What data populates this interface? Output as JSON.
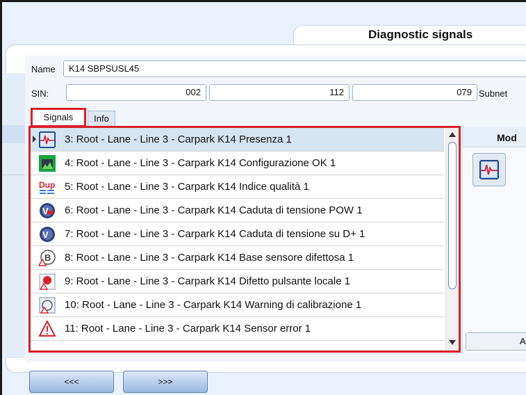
{
  "header": {
    "title": "Diagnostic signals"
  },
  "form": {
    "name_label": "Name",
    "name_value": "K14 SBPSUSL45",
    "sin_label": "SIN:",
    "sin_values": [
      "002",
      "112",
      "079"
    ],
    "subnet_label": "Subnet"
  },
  "tabs": [
    {
      "label": "Signals",
      "selected": true
    },
    {
      "label": "Info",
      "selected": false
    }
  ],
  "signals": [
    {
      "text": "3: Root - Lane - Line 3 - Carpark K14 Presenza 1",
      "icon": "presence-signal-icon",
      "selected": true
    },
    {
      "text": "4: Root - Lane - Line 3 - Carpark K14 Configurazione OK 1",
      "icon": "configuration-ok-icon"
    },
    {
      "text": "5: Root - Lane - Line 3 - Carpark K14 Indice qualità 1",
      "icon": "dup-quality-icon"
    },
    {
      "text": "6: Root - Lane - Line 3 - Carpark K14 Caduta di tensione POW 1",
      "icon": "voltage-pow-icon"
    },
    {
      "text": "7: Root - Lane - Line 3 - Carpark K14 Caduta di tensione su D+ 1",
      "icon": "voltage-dup-icon"
    },
    {
      "text": "8: Root - Lane - Line 3 - Carpark K14 Base sensore difettosa 1",
      "icon": "sensor-base-warning-icon"
    },
    {
      "text": "9: Root - Lane - Line 3 - Carpark K14 Difetto pulsante locale 1",
      "icon": "local-button-fault-icon"
    },
    {
      "text": "10: Root - Lane - Line 3 - Carpark K14 Warning di calibrazione 1",
      "icon": "calibration-warning-icon"
    },
    {
      "text": "11: Root - Lane - Line 3 - Carpark K14 Sensor error 1",
      "icon": "warning-triangle-icon"
    }
  ],
  "right_panel": {
    "mode_label": "Mod",
    "apply_label": "Ap",
    "mode_icon": "presence-signal-icon"
  },
  "nav": {
    "prev_label": "<<<",
    "next_label": ">>>"
  },
  "colors": {
    "highlight_border": "#d7202b",
    "selected_row": "#d4e5f1",
    "panel_bg": "#eaf1fa"
  }
}
